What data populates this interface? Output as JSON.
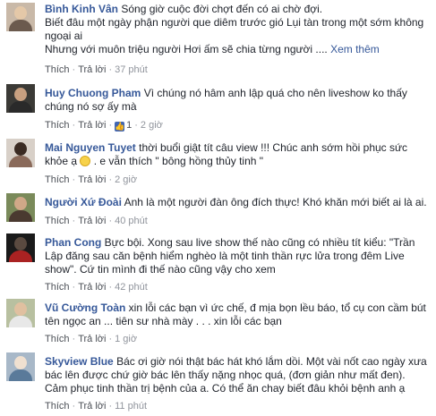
{
  "actions": {
    "like": "Thích",
    "reply": "Trả lời",
    "dot": "·"
  },
  "comments": [
    {
      "name": "Bình Kinh Vân",
      "line1": "Sóng giờ cuộc đời chợt đến có ai chờ đợi.",
      "line2": "Biết đâu một ngày phận người que diêm trước gió Lụi tàn trong một sớm không",
      "line3": "ngoại ai",
      "line4": "Nhưng với muôn triệu người Hơi ấm sẽ chia từng người ....",
      "see_more": "Xem thêm",
      "time": "37 phút"
    },
    {
      "name": "Huy Chuong Pham",
      "text_a": "Vì chúng nó hâm anh lập quá cho nên liveshow ko thấy",
      "text_b": "chúng nó sợ ấy mà",
      "likes": "1",
      "time": "2 giờ"
    },
    {
      "name": "Mai Nguyen Tuyet",
      "text_a": "thời buổi giật tít câu view !!! Chúc anh sớm hồi phục sức",
      "text_b1": "khỏe ạ",
      "text_b2": ". e vẫn thích \" bông hồng thủy tinh \"",
      "time": "2 giờ"
    },
    {
      "name": "Người Xứ Đoài",
      "text_a": "Anh là một người đàn ông đích thực! Khó khăn mới biết ai là ai.",
      "time": "40 phút"
    },
    {
      "name": "Phan Cong",
      "text_a": "Bực bội. Xong sau live show thế nào cũng có nhiều tít kiểu: \"Trần",
      "text_b": "Lập đăng sau căn bệnh hiểm nghèo là một tinh thần rực lửa trong đêm Live",
      "text_c": "show\". Cứ tin mình đi thế nào cũng vậy cho xem",
      "time": "42 phút"
    },
    {
      "name": "Vũ Cường Toàn",
      "text_a": "xin lỗi các bạn vì ức chế, đ mịa bọn lều báo, tổ cụ con cầm bút",
      "text_b": "tên ngọc an ... tiên sư nhà mày . . . xin lỗi các bạn",
      "time": "1 giờ"
    },
    {
      "name": "Skyview Blue",
      "text_a": "Bác ơi giờ nói thật bác hát khó lắm dồi. Một vài nốt cao ngày xưa",
      "text_b": "bác lên được chứ giờ bác lên thấy nặng nhọc quá, (đơn giản như mất đen).",
      "text_c": "Cảm phục tinh thần trị bệnh của a. Có thể ăn chay biết đâu khỏi bệnh anh ạ",
      "time": "11 phút"
    }
  ]
}
